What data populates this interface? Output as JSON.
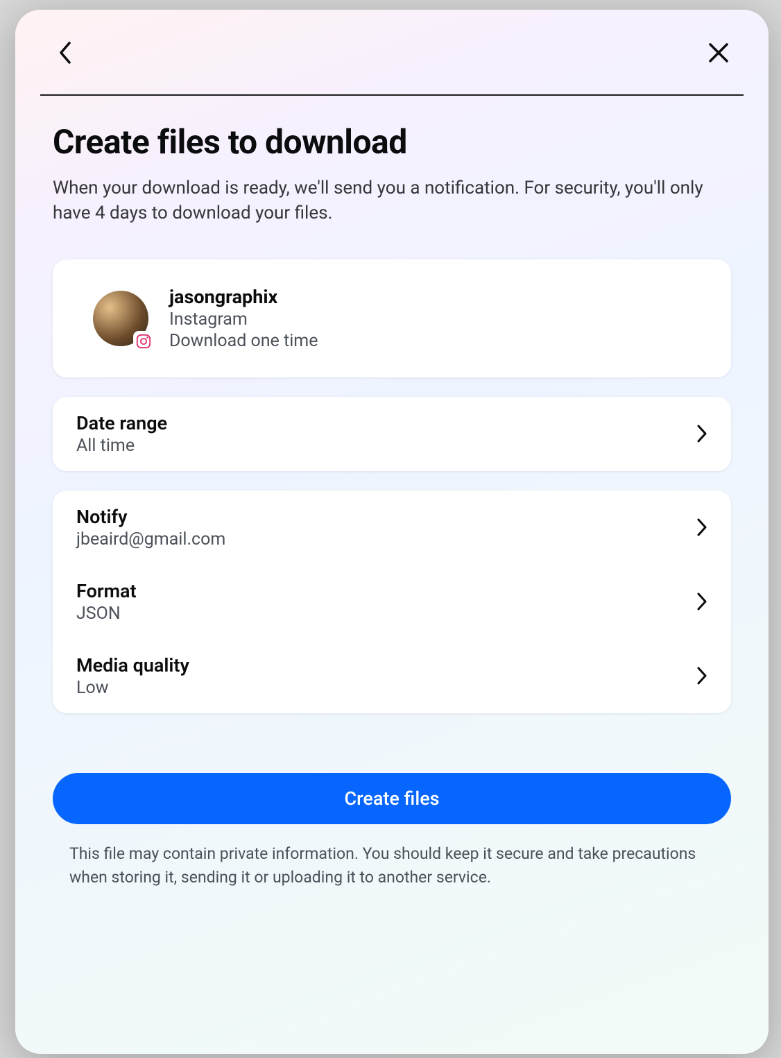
{
  "page": {
    "title": "Create files to download",
    "subtitle": "When your download is ready, we'll send you a notification. For security, you'll only have 4 days to download your files."
  },
  "account": {
    "username": "jasongraphix",
    "platform": "Instagram",
    "note": "Download one time"
  },
  "options": {
    "date_range": {
      "label": "Date range",
      "value": "All time"
    },
    "notify": {
      "label": "Notify",
      "value": "jbeaird@gmail.com"
    },
    "format": {
      "label": "Format",
      "value": "JSON"
    },
    "media_quality": {
      "label": "Media quality",
      "value": "Low"
    }
  },
  "actions": {
    "create": "Create files"
  },
  "footer": {
    "note": "This file may contain private information. You should keep it secure and take precautions when storing it, sending it or uploading it to another service."
  }
}
